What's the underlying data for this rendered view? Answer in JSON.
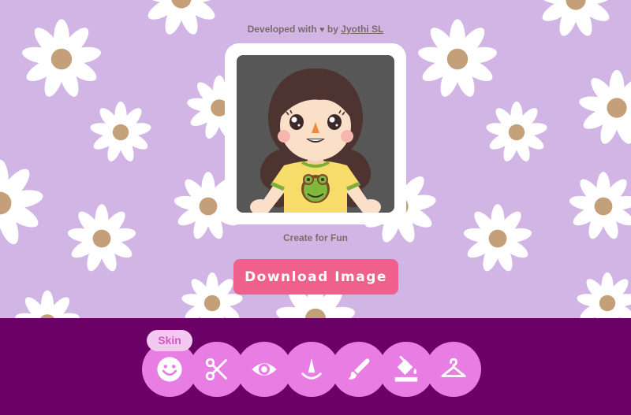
{
  "header": {
    "credit_prefix": "Developed with",
    "heart_glyph": "♥",
    "credit_by": "by",
    "author_link": "Jyothi SL"
  },
  "caption": "Create for Fun",
  "download_label": "Download Image",
  "toolbar": {
    "active_tool": "Skin",
    "tools": [
      {
        "name": "skin",
        "icon": "smiley-icon"
      },
      {
        "name": "hair",
        "icon": "scissors-icon"
      },
      {
        "name": "eyes",
        "icon": "eye-icon"
      },
      {
        "name": "nose",
        "icon": "nose-icon"
      },
      {
        "name": "brush",
        "icon": "brush-icon"
      },
      {
        "name": "color",
        "icon": "paint-bucket-icon"
      },
      {
        "name": "clothes",
        "icon": "hanger-icon"
      }
    ]
  },
  "colors": {
    "background": "#d1b6e5",
    "toolbar": "#6b0066",
    "tool_button": "#e87ee3",
    "download": "#f0608c",
    "tooltip": "#f4c9f1"
  }
}
